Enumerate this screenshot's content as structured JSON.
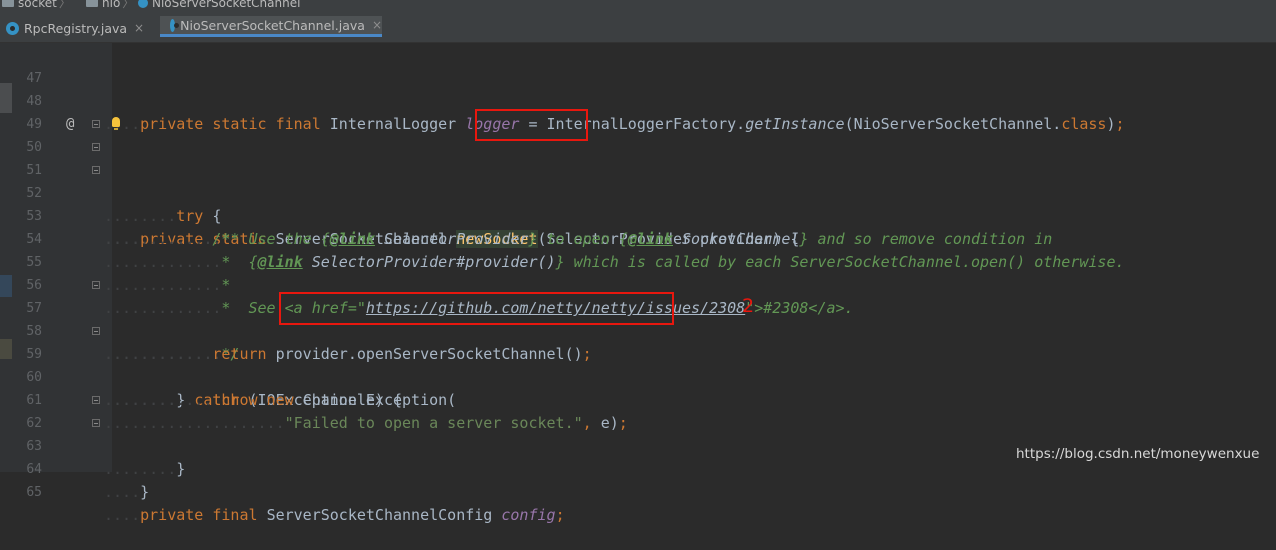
{
  "breadcrumb": [
    {
      "label": "socket",
      "icon": "folder-icon"
    },
    {
      "label": "nio",
      "icon": "folder-icon"
    },
    {
      "label": "NioServerSocketChannel",
      "icon": "class-icon"
    }
  ],
  "tabs": [
    {
      "label": "RpcRegistry.java",
      "active": false,
      "close": "×"
    },
    {
      "label": "NioServerSocketChannel.java",
      "active": true,
      "close": "×"
    }
  ],
  "editor": {
    "gutter_marks": {
      "overrides_marker": "@"
    },
    "lines": [
      {
        "n": "47",
        "text": ""
      },
      {
        "n": "48",
        "text": "    private static final InternalLogger logger = InternalLoggerFactory.getInstance(NioServerSocketChannel.class);"
      },
      {
        "n": "49",
        "text": ""
      },
      {
        "n": "50",
        "text": "    private static ServerSocketChannel newSocket(SelectorProvider provider) {"
      },
      {
        "n": "51",
        "text": "        try {"
      },
      {
        "n": "52",
        "text": "            /**"
      },
      {
        "n": "53",
        "text": "             *  Use the {@link SelectorProvider} to open {@link SocketChannel} and so remove condition in"
      },
      {
        "n": "54",
        "text": "             *  {@link SelectorProvider#provider()} which is called by each ServerSocketChannel.open() otherwise."
      },
      {
        "n": "55",
        "text": "             *"
      },
      {
        "n": "56",
        "text": "             *  See <a href=\"https://github.com/netty/netty/issues/2308\">#2308</a>."
      },
      {
        "n": "57",
        "text": "             */"
      },
      {
        "n": "58",
        "text": "            return provider.openServerSocketChannel();"
      },
      {
        "n": "59",
        "text": "        } catch (IOException e) {"
      },
      {
        "n": "60",
        "text": "            throw new ChannelException("
      },
      {
        "n": "61",
        "text": "                    \"Failed to open a server socket.\", e);"
      },
      {
        "n": "62",
        "text": "        }"
      },
      {
        "n": "63",
        "text": "    }"
      },
      {
        "n": "64",
        "text": ""
      },
      {
        "n": "65",
        "text": "    private final ServerSocketChannelConfig config;"
      }
    ]
  },
  "annotation": {
    "label": "2"
  },
  "watermark": "https://blog.csdn.net/moneywenxue",
  "colors": {
    "background": "#2b2b2b",
    "keyword": "#cc7832",
    "method_decl": "#ffc66d",
    "field": "#9876aa",
    "javadoc": "#629755",
    "string": "#6a8759",
    "annotation_box": "#e8170e",
    "tab_underline": "#4a88c7"
  }
}
